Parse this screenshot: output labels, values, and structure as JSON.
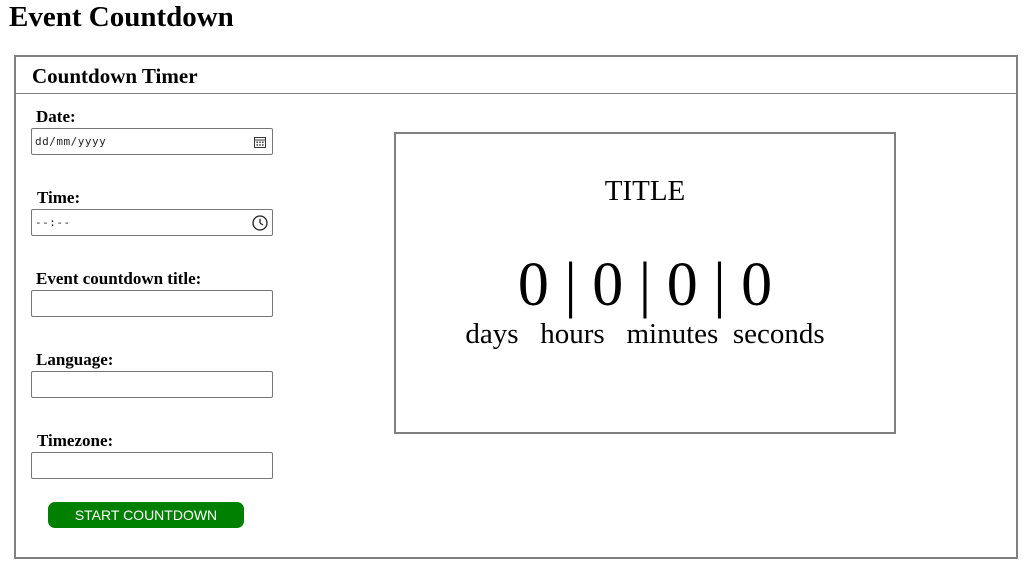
{
  "page": {
    "title": "Event Countdown"
  },
  "panel": {
    "title": "Countdown Timer"
  },
  "form": {
    "date": {
      "label": "Date:",
      "value": "dd/mm/yyyy",
      "icon": "calendar-icon"
    },
    "time": {
      "label": "Time:",
      "value": "--:--",
      "icon": "clock-icon"
    },
    "event_title": {
      "label": "Event countdown title:",
      "value": ""
    },
    "language": {
      "label": "Language:",
      "value": ""
    },
    "timezone": {
      "label": "Timezone:",
      "value": ""
    },
    "start_button": {
      "label": "START COUNTDOWN",
      "color": "#008000"
    }
  },
  "display": {
    "title": "TITLE",
    "days": "0",
    "hours": "0",
    "minutes": "0",
    "seconds": "0",
    "separator": "|",
    "units": {
      "days": "days",
      "hours": "hours",
      "minutes": "minutes",
      "seconds": "seconds"
    }
  }
}
